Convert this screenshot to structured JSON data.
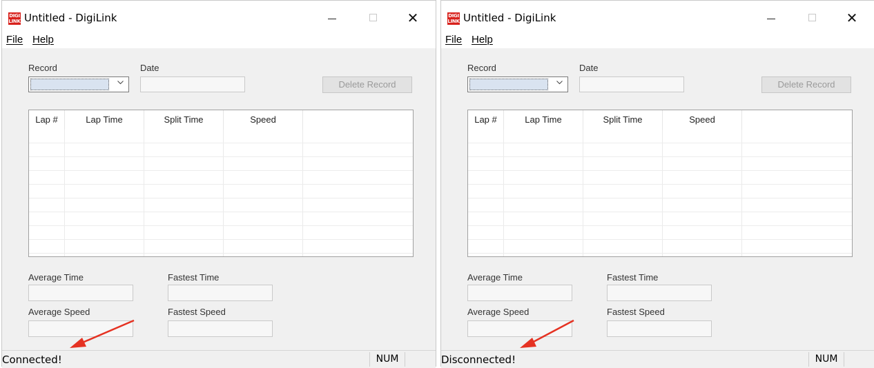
{
  "windows": [
    {
      "title": "Untitled - DigiLink",
      "logo_text_top": "DIGI",
      "logo_text_bottom": "LINK",
      "menu": [
        "File",
        "Help"
      ],
      "record_label": "Record",
      "date_label": "Date",
      "delete_button": "Delete Record",
      "table_headers": [
        "Lap #",
        "Lap Time",
        "Split Time",
        "Speed"
      ],
      "average_time_label": "Average Time",
      "fastest_time_label": "Fastest Time",
      "average_speed_label": "Average Speed",
      "fastest_speed_label": "Fastest Speed",
      "status": "Connected!",
      "num_indicator": "NUM"
    },
    {
      "title": "Untitled - DigiLink",
      "logo_text_top": "DIGI",
      "logo_text_bottom": "LINK",
      "menu": [
        "File",
        "Help"
      ],
      "record_label": "Record",
      "date_label": "Date",
      "delete_button": "Delete Record",
      "table_headers": [
        "Lap #",
        "Lap Time",
        "Split Time",
        "Speed"
      ],
      "average_time_label": "Average Time",
      "fastest_time_label": "Fastest Time",
      "average_speed_label": "Average Speed",
      "fastest_speed_label": "Fastest Speed",
      "status": "Disconnected!",
      "num_indicator": "NUM"
    }
  ],
  "colors": {
    "logo": "#d8211c",
    "annotation_arrow": "#e53222",
    "window_bg": "#f0f0f0"
  }
}
